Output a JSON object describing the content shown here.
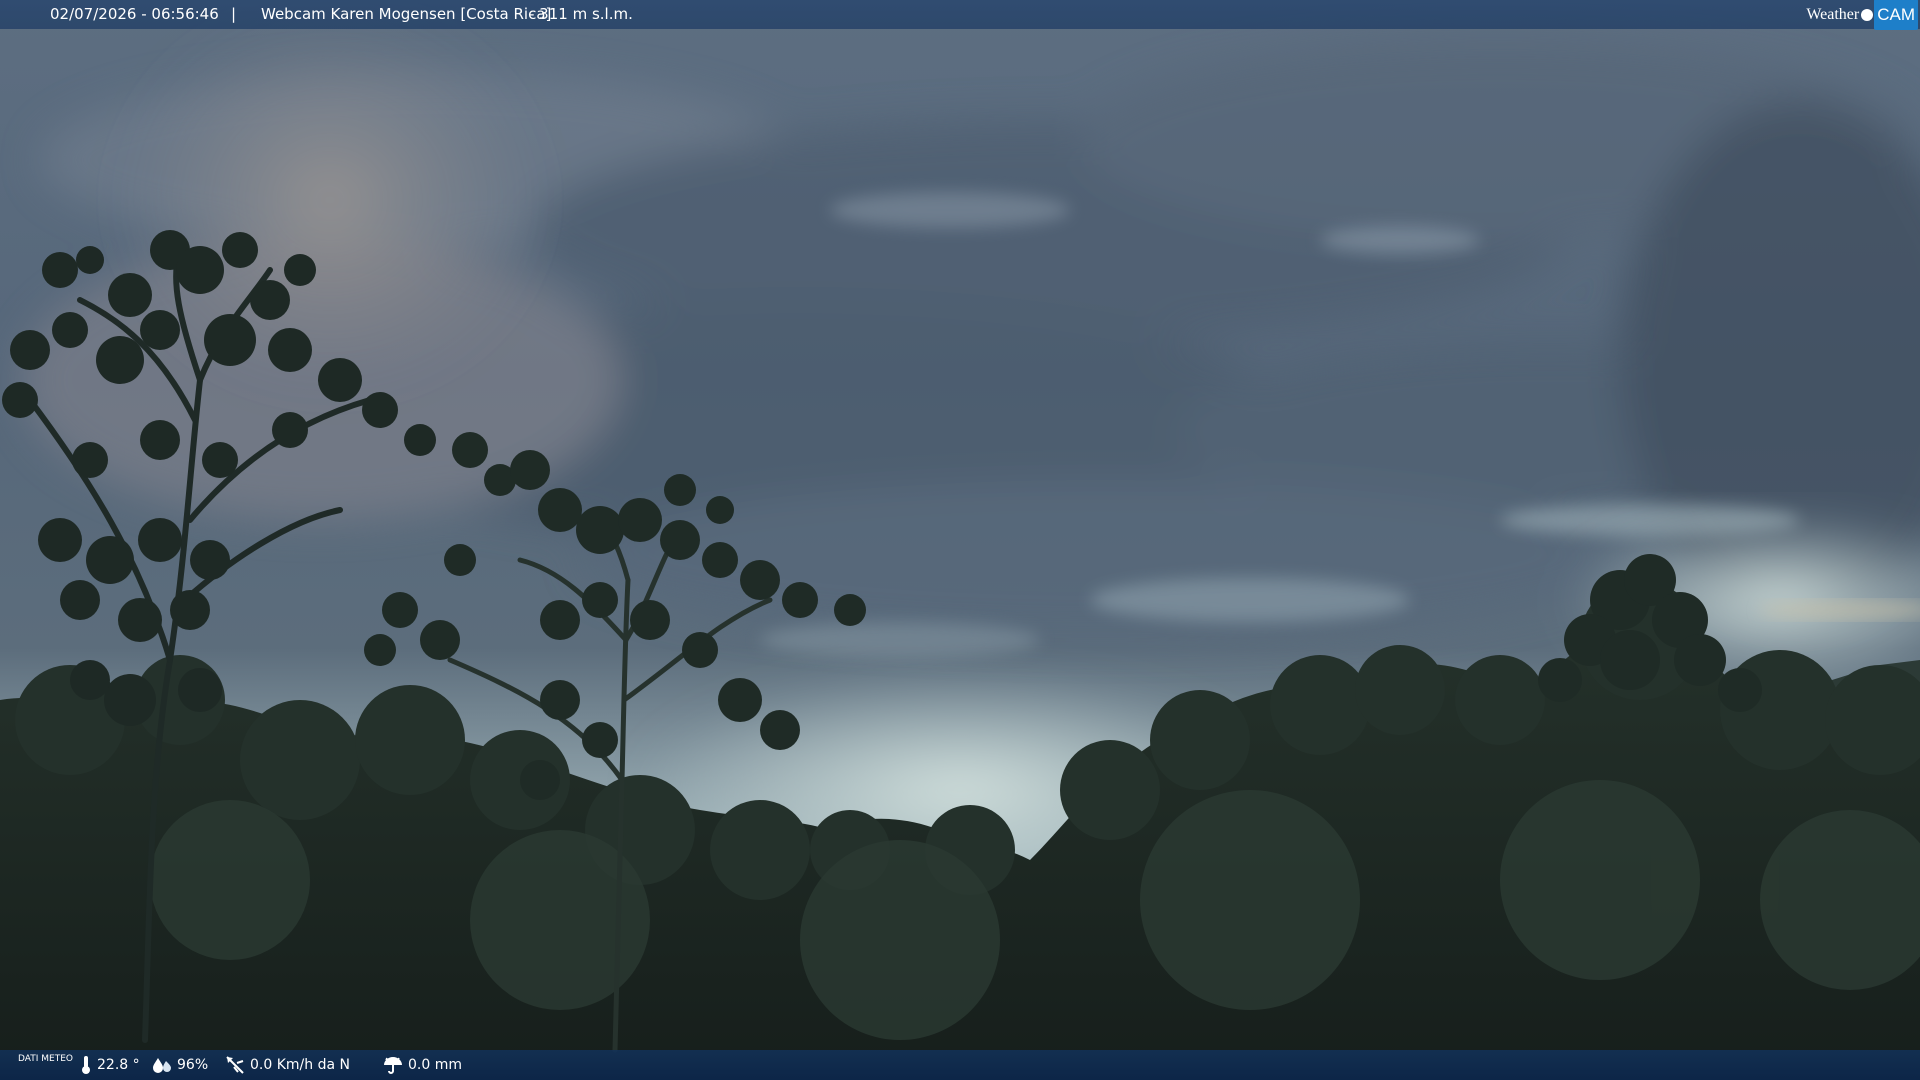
{
  "header": {
    "datetime": "02/07/2026 - 06:56:46",
    "separator": "|",
    "title": "Webcam Karen Mogensen [Costa Rica]",
    "altitude": "- 311 m s.l.m."
  },
  "logo": {
    "text_weather": "Weather",
    "text_cam": "CAM"
  },
  "footer": {
    "label": "DATI METEO",
    "temperature": "22.8 °",
    "humidity": "96%",
    "wind": "0.0 Km/h da N",
    "rain": "0.0 mm"
  },
  "icons": {
    "temperature": "thermometer-icon",
    "humidity": "droplets-icon",
    "wind": "wind-direction-icon",
    "rain": "rain-umbrella-icon"
  },
  "colors": {
    "top_bar": "#28466e",
    "bottom_bar": "#12325a",
    "logo_cam": "#1e7fc9",
    "sky_light": "#bfd3d4",
    "cloud_dark": "#4f5f71",
    "forest": "#1e2b25"
  }
}
